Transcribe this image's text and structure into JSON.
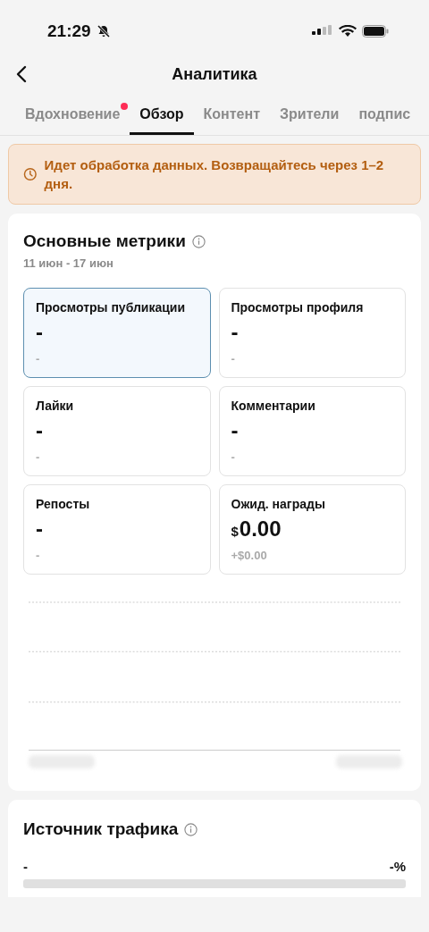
{
  "status_bar": {
    "time": "21:29"
  },
  "header": {
    "title": "Аналитика"
  },
  "tabs": [
    {
      "label": "Вдохновение",
      "selected": false,
      "dot": true
    },
    {
      "label": "Обзор",
      "selected": true,
      "dot": false
    },
    {
      "label": "Контент",
      "selected": false,
      "dot": false
    },
    {
      "label": "Зрители",
      "selected": false,
      "dot": false
    },
    {
      "label": "подпис",
      "selected": false,
      "dot": false
    }
  ],
  "notice": {
    "text": "Идет обработка данных. Возвращайтесь через 1–2 дня."
  },
  "metrics_card": {
    "title": "Основные метрики",
    "date_range": "11 июн - 17 июн",
    "metrics": [
      {
        "label": "Просмотры публикации",
        "value": "-",
        "change": "-",
        "selected": true
      },
      {
        "label": "Просмотры профиля",
        "value": "-",
        "change": "-",
        "selected": false
      },
      {
        "label": "Лайки",
        "value": "-",
        "change": "-",
        "selected": false
      },
      {
        "label": "Комментарии",
        "value": "-",
        "change": "-",
        "selected": false
      },
      {
        "label": "Репосты",
        "value": "-",
        "change": "-",
        "selected": false
      },
      {
        "label": "Ожид. награды",
        "currency": "$",
        "value": "0.00",
        "change": "+$0.00",
        "selected": false
      }
    ]
  },
  "traffic_card": {
    "title": "Источник трафика",
    "source": "-",
    "percent": "-%"
  }
}
